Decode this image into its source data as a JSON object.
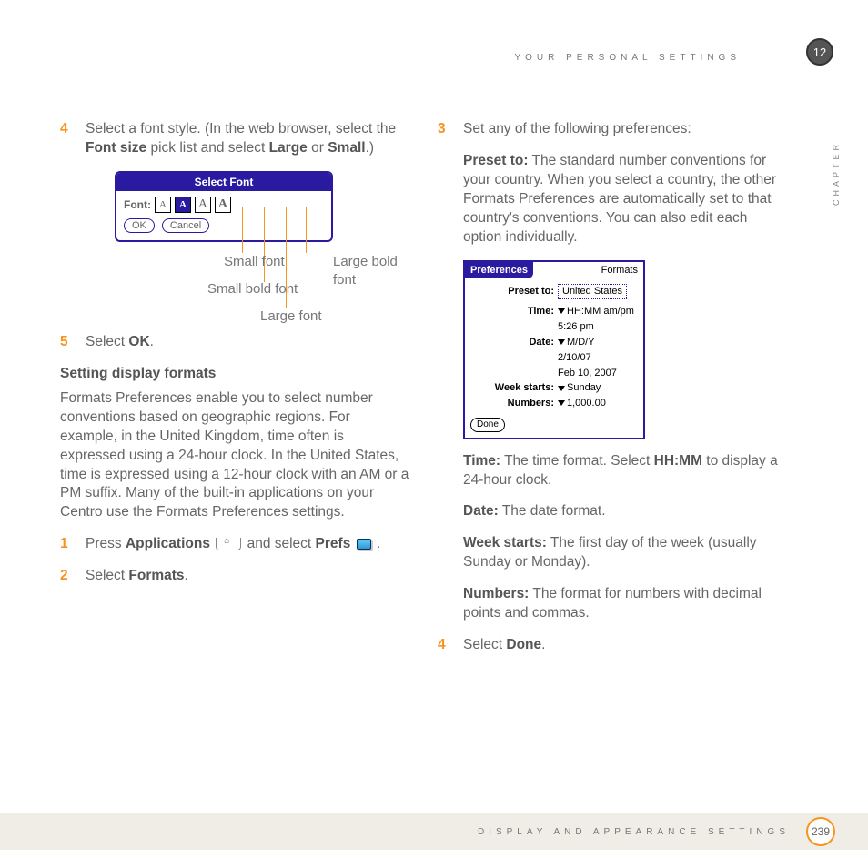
{
  "header": {
    "section": "YOUR PERSONAL SETTINGS",
    "chapter_number": "12",
    "chapter_label": "CHAPTER"
  },
  "left": {
    "step4": {
      "num": "4",
      "text_a": "Select a font style. (In the web browser, select the ",
      "b1": "Font size",
      "text_b": " pick list and select ",
      "b2": "Large",
      "text_c": " or ",
      "b3": "Small",
      "text_d": ".)"
    },
    "font_dialog": {
      "title": "Select Font",
      "label": "Font:",
      "ok": "OK",
      "cancel": "Cancel"
    },
    "callouts": {
      "small": "Small font",
      "small_bold": "Small bold font",
      "large": "Large font",
      "large_bold": "Large bold font"
    },
    "step5": {
      "num": "5",
      "text_a": "Select ",
      "b1": "OK",
      "text_b": "."
    },
    "heading": "Setting display formats",
    "formats_para": "Formats Preferences enable you to select number conventions based on geographic regions. For example, in the United Kingdom, time often is expressed using a 24-hour clock. In the United States, time is expressed using a 12-hour clock with an AM or a PM suffix. Many of the built-in applications on your Centro use the Formats Preferences settings.",
    "step1": {
      "num": "1",
      "text_a": "Press ",
      "b1": "Applications",
      "text_b": " and select ",
      "b2": "Prefs",
      "text_c": " ."
    },
    "step2": {
      "num": "2",
      "text_a": "Select ",
      "b1": "Formats",
      "text_b": "."
    }
  },
  "right": {
    "step3": {
      "num": "3",
      "text": "Set any of the following preferences:"
    },
    "preset": {
      "label": "Preset to:",
      "text": " The standard number conventions for your country. When you select a country, the other Formats Preferences are automatically set to that country's conventions. You can also edit each option individually."
    },
    "prefs_shot": {
      "tab": "Preferences",
      "title": "Formats",
      "preset_lbl": "Preset to:",
      "preset_val": "United States",
      "time_lbl": "Time:",
      "time_val": "HH:MM am/pm",
      "time_ex": "5:26 pm",
      "date_lbl": "Date:",
      "date_val": "M/D/Y",
      "date_ex1": "2/10/07",
      "date_ex2": "Feb 10, 2007",
      "week_lbl": "Week starts:",
      "week_val": "Sunday",
      "num_lbl": "Numbers:",
      "num_val": "1,000.00",
      "done": "Done"
    },
    "time": {
      "label": "Time:",
      "text_a": " The time format. Select ",
      "b1": "HH:MM",
      "text_b": " to display a 24-hour clock."
    },
    "date": {
      "label": "Date:",
      "text": " The date format."
    },
    "week": {
      "label": "Week starts:",
      "text": " The first day of the week (usually Sunday or Monday)."
    },
    "numbers": {
      "label": "Numbers:",
      "text": " The format for numbers with decimal points and commas."
    },
    "step4": {
      "num": "4",
      "text_a": "Select ",
      "b1": "Done",
      "text_b": "."
    }
  },
  "footer": {
    "section": "DISPLAY AND APPEARANCE SETTINGS",
    "page": "239"
  }
}
